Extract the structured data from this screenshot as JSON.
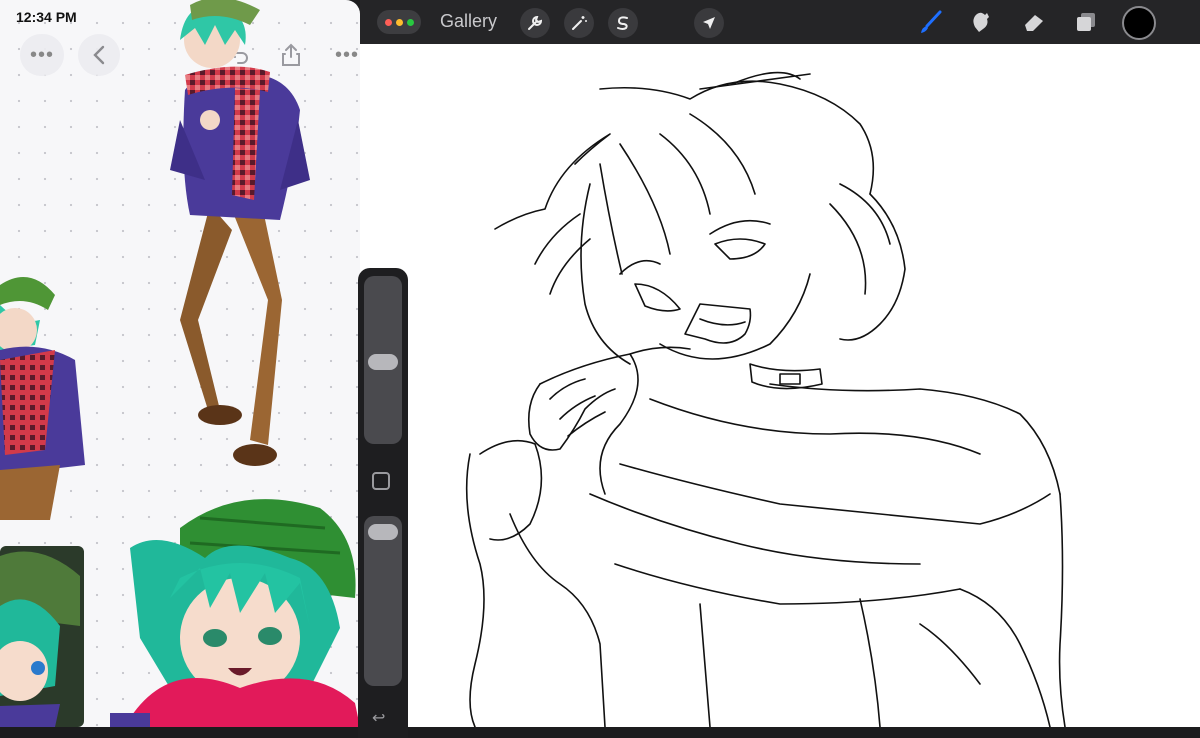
{
  "status_bar": {
    "time": "12:34 PM"
  },
  "left_app": {
    "toolbar_icons": [
      "more-icon",
      "chevron-left-icon",
      "undo-icon",
      "share-icon",
      "more-icon"
    ]
  },
  "procreate": {
    "gallery_label": "Gallery",
    "tools_left": [
      "wrench-icon",
      "magic-wand-icon",
      "selection-s-icon",
      "arrow-cursor-icon"
    ],
    "tools_right": [
      "brush-icon",
      "smudge-icon",
      "eraser-icon",
      "layers-icon"
    ],
    "brush_accent_color": "#1e6fff",
    "current_color": "#000000",
    "window_dots_colors": [
      "#ff5f57",
      "#febc2e",
      "#28c840"
    ]
  },
  "sidebar": {
    "controls": [
      "size-slider",
      "modify-square",
      "opacity-slider",
      "undo-arrow"
    ]
  }
}
